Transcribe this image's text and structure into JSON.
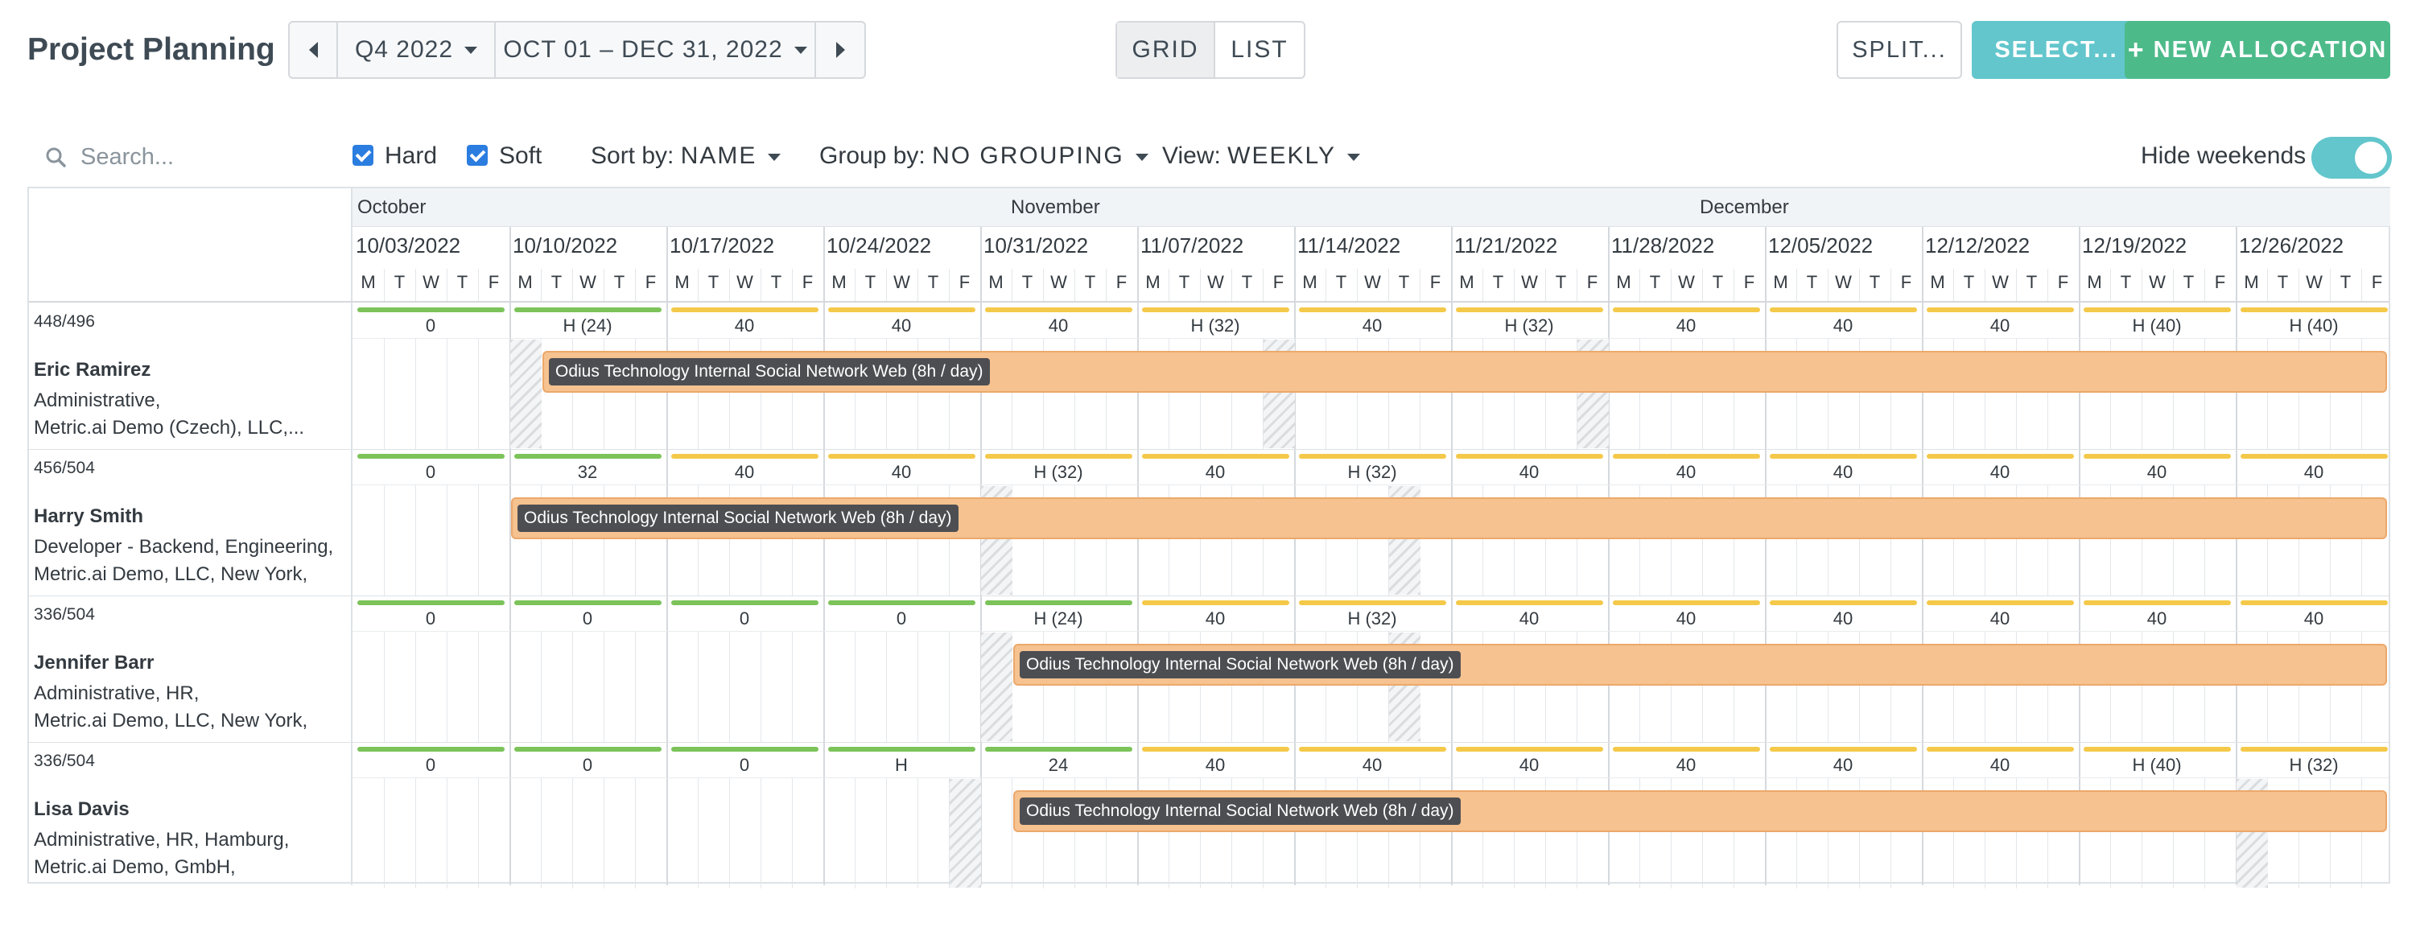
{
  "title": "Project Planning",
  "nav": {
    "quarter": "Q4 2022",
    "range": "OCT 01 – DEC 31, 2022"
  },
  "views": {
    "grid": "GRID",
    "list": "LIST"
  },
  "buttons": {
    "split": "SPLIT...",
    "select": "SELECT...",
    "new_allocation": "NEW ALLOCATION"
  },
  "filters": {
    "search_placeholder": "Search...",
    "hard": "Hard",
    "soft": "Soft",
    "sort_label": "Sort by:",
    "sort_value": "NAME",
    "group_label": "Group by:",
    "group_value": "NO GROUPING",
    "view_label": "View:",
    "view_value": "WEEKLY",
    "hide_weekends": "Hide weekends"
  },
  "months": [
    "October",
    "November",
    "December"
  ],
  "weeks": [
    "10/03/2022",
    "10/10/2022",
    "10/17/2022",
    "10/24/2022",
    "10/31/2022",
    "11/07/2022",
    "11/14/2022",
    "11/21/2022",
    "11/28/2022",
    "12/05/2022",
    "12/12/2022",
    "12/19/2022",
    "12/26/2022"
  ],
  "days": [
    "M",
    "T",
    "W",
    "T",
    "F"
  ],
  "colors": {
    "green": "#7cc35a",
    "yellow": "#f4c94a",
    "allocation": "#f5c290",
    "teal": "#62c6cc",
    "new": "#4dba8a"
  },
  "people": [
    {
      "summary": "448/496",
      "name": "Eric Ramirez",
      "line1": "Administrative,",
      "line2": "Metric.ai Demo (Czech), LLC,...",
      "capacity": [
        "0",
        "H (24)",
        "40",
        "40",
        "40",
        "H (32)",
        "40",
        "H (32)",
        "40",
        "40",
        "40",
        "H (40)",
        "H (40)"
      ],
      "bars": [
        "green",
        "green",
        "yellow",
        "yellow",
        "yellow",
        "yellow",
        "yellow",
        "yellow",
        "yellow",
        "yellow",
        "yellow",
        "yellow",
        "yellow"
      ],
      "allocation": "Odius Technology Internal Social Network Web (8h / day)"
    },
    {
      "summary": "456/504",
      "name": "Harry Smith",
      "line1": "Developer - Backend, Engineering,",
      "line2": "Metric.ai Demo, LLC, New York,",
      "capacity": [
        "0",
        "32",
        "40",
        "40",
        "H (32)",
        "40",
        "H (32)",
        "40",
        "40",
        "40",
        "40",
        "40",
        "40"
      ],
      "bars": [
        "green",
        "green",
        "yellow",
        "yellow",
        "yellow",
        "yellow",
        "yellow",
        "yellow",
        "yellow",
        "yellow",
        "yellow",
        "yellow",
        "yellow"
      ],
      "allocation": "Odius Technology Internal Social Network Web (8h / day)"
    },
    {
      "summary": "336/504",
      "name": "Jennifer Barr",
      "line1": "Administrative, HR,",
      "line2": "Metric.ai Demo, LLC, New York,",
      "capacity": [
        "0",
        "0",
        "0",
        "0",
        "H (24)",
        "40",
        "H (32)",
        "40",
        "40",
        "40",
        "40",
        "40",
        "40"
      ],
      "bars": [
        "green",
        "green",
        "green",
        "green",
        "green",
        "yellow",
        "yellow",
        "yellow",
        "yellow",
        "yellow",
        "yellow",
        "yellow",
        "yellow"
      ],
      "allocation": "Odius Technology Internal Social Network Web (8h / day)"
    },
    {
      "summary": "336/504",
      "name": "Lisa Davis",
      "line1": "Administrative, HR, Hamburg,",
      "line2": "Metric.ai Demo, GmbH,",
      "capacity": [
        "0",
        "0",
        "0",
        "H",
        "24",
        "40",
        "40",
        "40",
        "40",
        "40",
        "40",
        "H (40)",
        "H (32)"
      ],
      "bars": [
        "green",
        "green",
        "green",
        "green",
        "green",
        "yellow",
        "yellow",
        "yellow",
        "yellow",
        "yellow",
        "yellow",
        "yellow",
        "yellow"
      ],
      "allocation": "Odius Technology Internal Social Network Web (8h / day)"
    }
  ]
}
